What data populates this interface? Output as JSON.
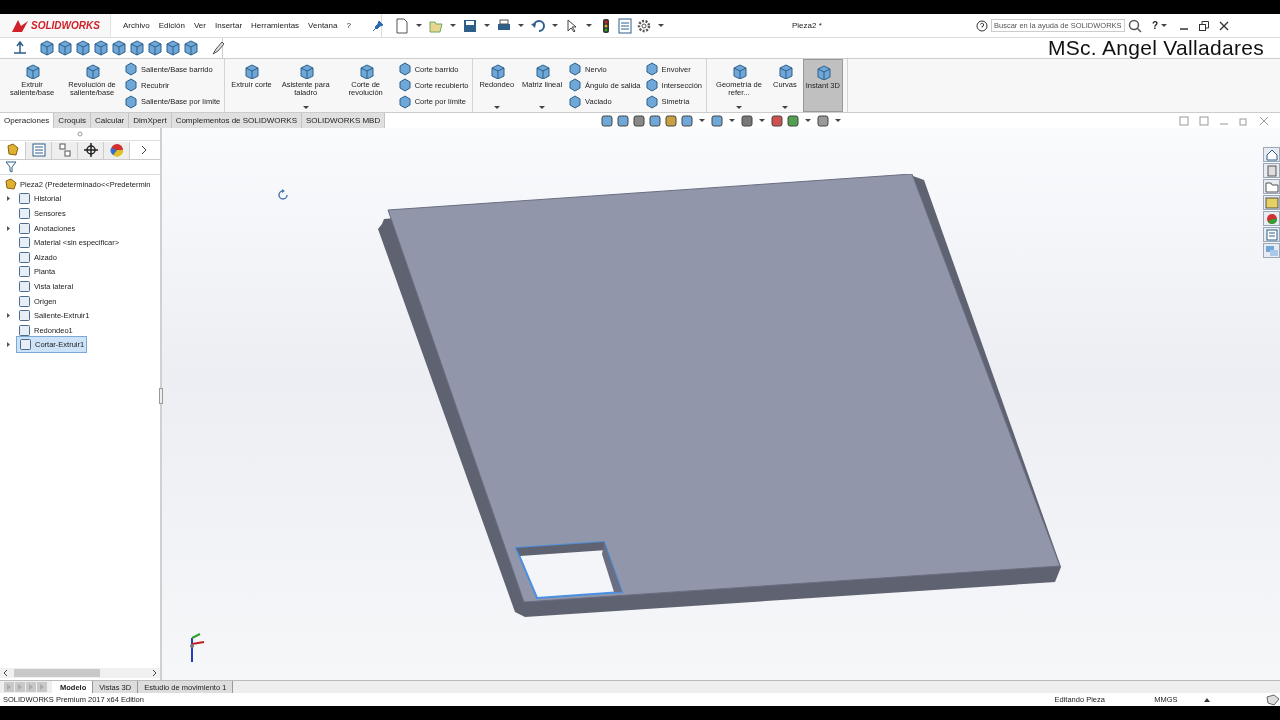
{
  "overlay_text": "MSc. Angel Valladares",
  "titlebar": {
    "app_name": "SOLIDWORKS",
    "menus": [
      "Archivo",
      "Edición",
      "Ver",
      "Insertar",
      "Herramientas",
      "Ventana",
      "?"
    ],
    "document_title": "Pieza2 *",
    "search": {
      "placeholder": "Buscar en la ayuda de SOLIDWORKS"
    },
    "help": "?"
  },
  "ribbon": {
    "groups": [
      {
        "columns": [
          {
            "kind": "large",
            "label": "Extruir saliente/base",
            "dropdown": false,
            "selected": false
          },
          {
            "kind": "large",
            "label": "Revolución de saliente/base",
            "dropdown": false,
            "selected": false
          },
          {
            "kind": "stack",
            "items": [
              "Saliente/Base barrido",
              "Recubrir",
              "Saliente/Base por límite"
            ]
          }
        ]
      },
      {
        "columns": [
          {
            "kind": "large",
            "label": "Extruir corte",
            "dropdown": false,
            "selected": false
          },
          {
            "kind": "large",
            "label": "Asistente para taladro",
            "dropdown": true,
            "selected": false
          },
          {
            "kind": "large",
            "label": "Corte de revolución",
            "dropdown": false,
            "selected": false
          },
          {
            "kind": "stack",
            "items": [
              "Corte barrido",
              "Corte recubierto",
              "Corte por límite"
            ]
          }
        ]
      },
      {
        "columns": [
          {
            "kind": "large",
            "label": "Redondeo",
            "dropdown": true,
            "selected": false
          },
          {
            "kind": "large",
            "label": "Matriz lineal",
            "dropdown": true,
            "selected": false
          },
          {
            "kind": "stack",
            "items": [
              "Nervio",
              "Ángulo de salida",
              "Vaciado"
            ]
          },
          {
            "kind": "stack",
            "items": [
              "Envolver",
              "Intersección",
              "Simetría"
            ]
          }
        ]
      },
      {
        "columns": [
          {
            "kind": "large",
            "label": "Geometría de refer...",
            "dropdown": true,
            "selected": false
          },
          {
            "kind": "large",
            "label": "Curvas",
            "dropdown": true,
            "selected": false
          },
          {
            "kind": "large",
            "label": "Instant 3D",
            "dropdown": false,
            "selected": true
          }
        ]
      }
    ]
  },
  "tabs": [
    {
      "label": "Operaciones",
      "selected": true
    },
    {
      "label": "Croquis",
      "selected": false
    },
    {
      "label": "Calcular",
      "selected": false
    },
    {
      "label": "DimXpert",
      "selected": false
    },
    {
      "label": "Complementos de SOLIDWORKS",
      "selected": false
    },
    {
      "label": "SOLIDWORKS MBD",
      "selected": false
    }
  ],
  "feature_tree": {
    "root": "Pieza2  (Predeterminado<<Predetermin",
    "items": [
      {
        "label": "Historial",
        "expandable": true,
        "selected": false
      },
      {
        "label": "Sensores",
        "expandable": false,
        "selected": false
      },
      {
        "label": "Anotaciones",
        "expandable": true,
        "selected": false
      },
      {
        "label": "Material <sin especificar>",
        "expandable": false,
        "selected": false
      },
      {
        "label": "Alzado",
        "expandable": false,
        "selected": false
      },
      {
        "label": "Planta",
        "expandable": false,
        "selected": false
      },
      {
        "label": "Vista lateral",
        "expandable": false,
        "selected": false
      },
      {
        "label": "Origen",
        "expandable": false,
        "selected": false
      },
      {
        "label": "Saliente-Extruir1",
        "expandable": true,
        "selected": false
      },
      {
        "label": "Redondeo1",
        "expandable": false,
        "selected": false
      },
      {
        "label": "Cortar-Extruir1",
        "expandable": true,
        "selected": true
      }
    ]
  },
  "bottom_tabs": [
    {
      "label": "Modelo",
      "selected": true
    },
    {
      "label": "Vistas 3D",
      "selected": false
    },
    {
      "label": "Estudio de movimiento 1",
      "selected": false
    }
  ],
  "status_bar": {
    "edition": "SOLIDWORKS Premium 2017 x64 Edition",
    "mode": "Editando Pieza",
    "units": "MMGS"
  }
}
